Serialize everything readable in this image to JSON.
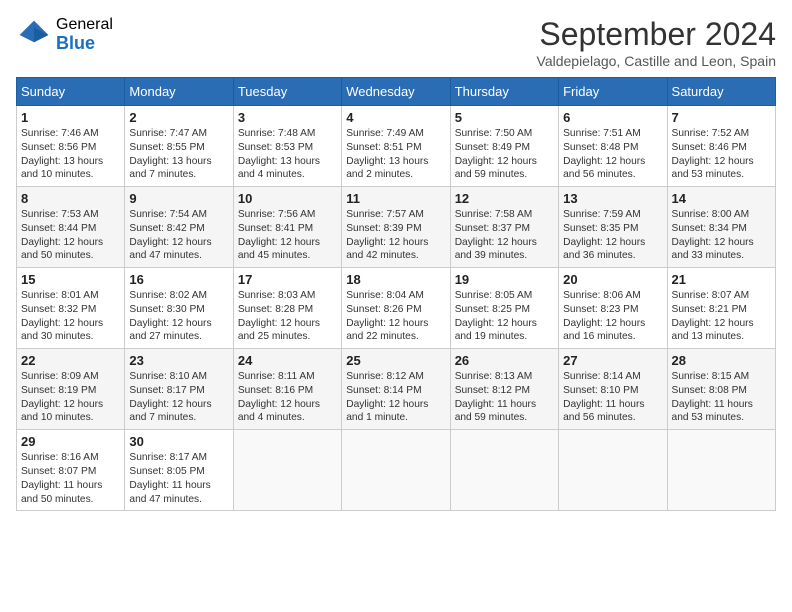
{
  "header": {
    "logo_general": "General",
    "logo_blue": "Blue",
    "month_title": "September 2024",
    "location": "Valdepielago, Castille and Leon, Spain"
  },
  "weekdays": [
    "Sunday",
    "Monday",
    "Tuesday",
    "Wednesday",
    "Thursday",
    "Friday",
    "Saturday"
  ],
  "weeks": [
    [
      {
        "day": "1",
        "info": "Sunrise: 7:46 AM\nSunset: 8:56 PM\nDaylight: 13 hours\nand 10 minutes."
      },
      {
        "day": "2",
        "info": "Sunrise: 7:47 AM\nSunset: 8:55 PM\nDaylight: 13 hours\nand 7 minutes."
      },
      {
        "day": "3",
        "info": "Sunrise: 7:48 AM\nSunset: 8:53 PM\nDaylight: 13 hours\nand 4 minutes."
      },
      {
        "day": "4",
        "info": "Sunrise: 7:49 AM\nSunset: 8:51 PM\nDaylight: 13 hours\nand 2 minutes."
      },
      {
        "day": "5",
        "info": "Sunrise: 7:50 AM\nSunset: 8:49 PM\nDaylight: 12 hours\nand 59 minutes."
      },
      {
        "day": "6",
        "info": "Sunrise: 7:51 AM\nSunset: 8:48 PM\nDaylight: 12 hours\nand 56 minutes."
      },
      {
        "day": "7",
        "info": "Sunrise: 7:52 AM\nSunset: 8:46 PM\nDaylight: 12 hours\nand 53 minutes."
      }
    ],
    [
      {
        "day": "8",
        "info": "Sunrise: 7:53 AM\nSunset: 8:44 PM\nDaylight: 12 hours\nand 50 minutes."
      },
      {
        "day": "9",
        "info": "Sunrise: 7:54 AM\nSunset: 8:42 PM\nDaylight: 12 hours\nand 47 minutes."
      },
      {
        "day": "10",
        "info": "Sunrise: 7:56 AM\nSunset: 8:41 PM\nDaylight: 12 hours\nand 45 minutes."
      },
      {
        "day": "11",
        "info": "Sunrise: 7:57 AM\nSunset: 8:39 PM\nDaylight: 12 hours\nand 42 minutes."
      },
      {
        "day": "12",
        "info": "Sunrise: 7:58 AM\nSunset: 8:37 PM\nDaylight: 12 hours\nand 39 minutes."
      },
      {
        "day": "13",
        "info": "Sunrise: 7:59 AM\nSunset: 8:35 PM\nDaylight: 12 hours\nand 36 minutes."
      },
      {
        "day": "14",
        "info": "Sunrise: 8:00 AM\nSunset: 8:34 PM\nDaylight: 12 hours\nand 33 minutes."
      }
    ],
    [
      {
        "day": "15",
        "info": "Sunrise: 8:01 AM\nSunset: 8:32 PM\nDaylight: 12 hours\nand 30 minutes."
      },
      {
        "day": "16",
        "info": "Sunrise: 8:02 AM\nSunset: 8:30 PM\nDaylight: 12 hours\nand 27 minutes."
      },
      {
        "day": "17",
        "info": "Sunrise: 8:03 AM\nSunset: 8:28 PM\nDaylight: 12 hours\nand 25 minutes."
      },
      {
        "day": "18",
        "info": "Sunrise: 8:04 AM\nSunset: 8:26 PM\nDaylight: 12 hours\nand 22 minutes."
      },
      {
        "day": "19",
        "info": "Sunrise: 8:05 AM\nSunset: 8:25 PM\nDaylight: 12 hours\nand 19 minutes."
      },
      {
        "day": "20",
        "info": "Sunrise: 8:06 AM\nSunset: 8:23 PM\nDaylight: 12 hours\nand 16 minutes."
      },
      {
        "day": "21",
        "info": "Sunrise: 8:07 AM\nSunset: 8:21 PM\nDaylight: 12 hours\nand 13 minutes."
      }
    ],
    [
      {
        "day": "22",
        "info": "Sunrise: 8:09 AM\nSunset: 8:19 PM\nDaylight: 12 hours\nand 10 minutes."
      },
      {
        "day": "23",
        "info": "Sunrise: 8:10 AM\nSunset: 8:17 PM\nDaylight: 12 hours\nand 7 minutes."
      },
      {
        "day": "24",
        "info": "Sunrise: 8:11 AM\nSunset: 8:16 PM\nDaylight: 12 hours\nand 4 minutes."
      },
      {
        "day": "25",
        "info": "Sunrise: 8:12 AM\nSunset: 8:14 PM\nDaylight: 12 hours\nand 1 minute."
      },
      {
        "day": "26",
        "info": "Sunrise: 8:13 AM\nSunset: 8:12 PM\nDaylight: 11 hours\nand 59 minutes."
      },
      {
        "day": "27",
        "info": "Sunrise: 8:14 AM\nSunset: 8:10 PM\nDaylight: 11 hours\nand 56 minutes."
      },
      {
        "day": "28",
        "info": "Sunrise: 8:15 AM\nSunset: 8:08 PM\nDaylight: 11 hours\nand 53 minutes."
      }
    ],
    [
      {
        "day": "29",
        "info": "Sunrise: 8:16 AM\nSunset: 8:07 PM\nDaylight: 11 hours\nand 50 minutes."
      },
      {
        "day": "30",
        "info": "Sunrise: 8:17 AM\nSunset: 8:05 PM\nDaylight: 11 hours\nand 47 minutes."
      },
      {
        "day": "",
        "info": ""
      },
      {
        "day": "",
        "info": ""
      },
      {
        "day": "",
        "info": ""
      },
      {
        "day": "",
        "info": ""
      },
      {
        "day": "",
        "info": ""
      }
    ]
  ]
}
